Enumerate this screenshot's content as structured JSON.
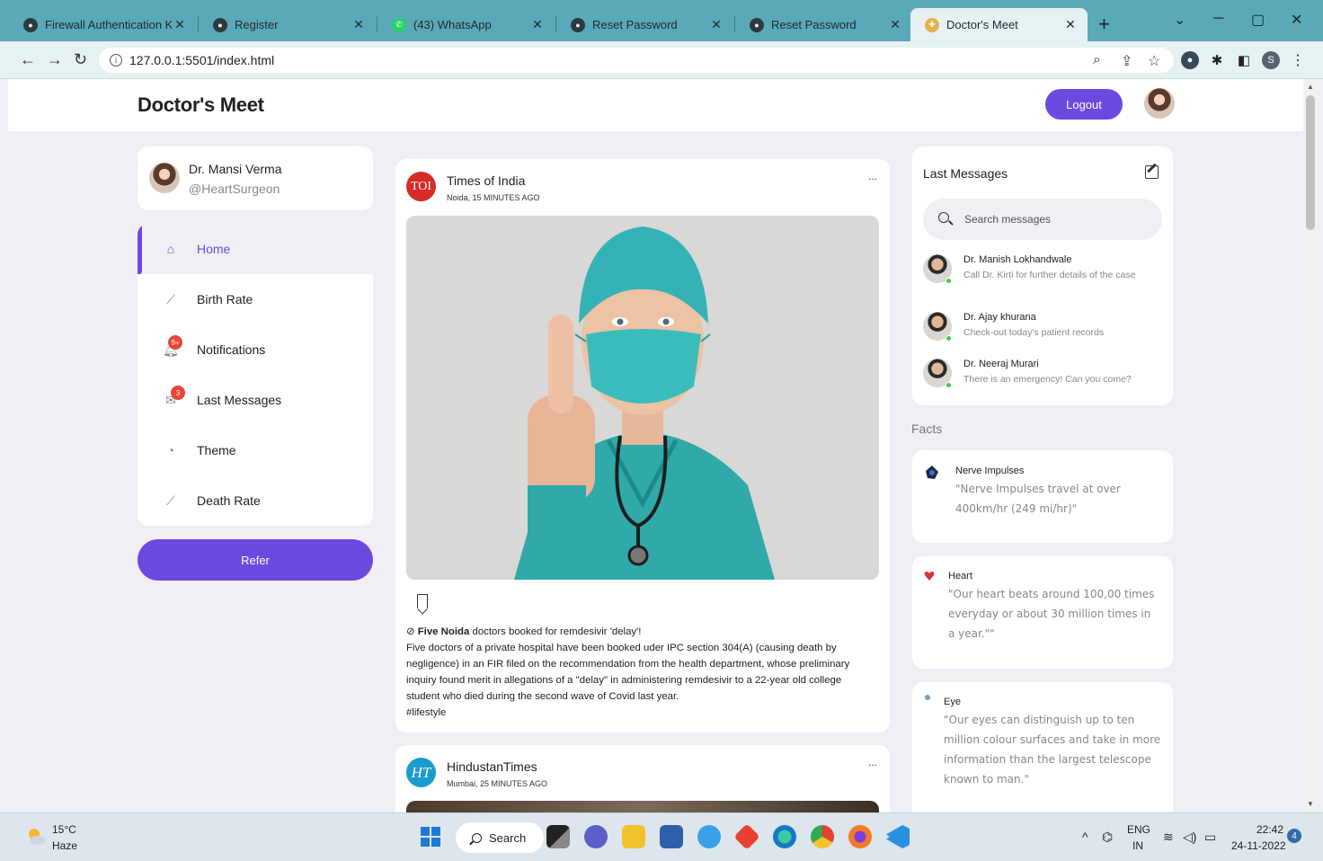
{
  "browser": {
    "tabs": [
      {
        "title": "Firewall Authentication Keep",
        "icon": "globe-icon"
      },
      {
        "title": "Register",
        "icon": "globe-icon"
      },
      {
        "title": "(43) WhatsApp",
        "icon": "whatsapp-icon"
      },
      {
        "title": "Reset Password",
        "icon": "globe-icon"
      },
      {
        "title": "Reset Password",
        "icon": "globe-icon"
      },
      {
        "title": "Doctor's Meet",
        "icon": "doctor-icon"
      }
    ],
    "url": "127.0.0.1:5501/index.html",
    "profile_initial": "S"
  },
  "header": {
    "logo": "Doctor's Meet",
    "logout_label": "Logout"
  },
  "profile": {
    "name": "Dr. Mansi Verma",
    "handle": "@HeartSurgeon"
  },
  "menu": [
    {
      "label": "Home",
      "icon": "home-icon",
      "active": true
    },
    {
      "label": "Birth Rate",
      "icon": "chart-line-icon"
    },
    {
      "label": "Notifications",
      "icon": "bell-icon",
      "badge": "9+"
    },
    {
      "label": "Last Messages",
      "icon": "mail-icon",
      "badge": "3"
    },
    {
      "label": "Theme",
      "icon": "palette-icon"
    },
    {
      "label": "Death Rate",
      "icon": "chart-line-icon"
    }
  ],
  "refer_label": "Refer",
  "posts": [
    {
      "source": "Times of India",
      "logo_text": "TOI",
      "meta": "Noida, 15 MINUTES AGO",
      "more": "...",
      "headline_bold": "Five Noida",
      "headline_rest": " doctors booked for remdesivir 'delay'!",
      "body": "Five doctors of a private hospital have been booked uder IPC section 304(A) (causing death by negligence) in an FIR filed on the recommendation from the health department, whose preliminary inquiry found merit in allegations of a \"delay\" in administering remdesivir to a 22-year old college student who died during the second wave of Covid last year.",
      "tag": "#lifestyle"
    },
    {
      "source": "HindustanTimes",
      "logo_text": "HT",
      "meta": "Mumbai, 25 MINUTES AGO",
      "more": "..."
    }
  ],
  "messages": {
    "title": "Last Messages",
    "search_placeholder": "Search messages",
    "items": [
      {
        "name": "Dr. Manish Lokhandwale",
        "preview": "Call Dr. Kirti for further details of the case"
      },
      {
        "name": "Dr. Ajay khurana",
        "preview": "Check-out today's patient records"
      },
      {
        "name": "Dr. Neeraj Murari",
        "preview": "There is an emergency! Can you come?"
      }
    ]
  },
  "facts": {
    "title": "Facts",
    "items": [
      {
        "name": "Nerve Impulses",
        "text": "\"Nerve Impulses travel at over 400km/hr (249 mi/hr)\"",
        "icon": "neuron-icon"
      },
      {
        "name": "Heart",
        "text": "\"Our heart beats around 100,00 times everyday or about 30 million times in a year.\"\"",
        "icon": "heart-icon"
      },
      {
        "name": "Eye",
        "text": "\"Our eyes can distinguish up to ten million colour surfaces and take in more information than the largest telescope known to man.\"",
        "icon": "eye-icon"
      }
    ]
  },
  "taskbar": {
    "temperature": "15°C",
    "condition": "Haze",
    "search_label": "Search",
    "language": "ENG",
    "region": "IN",
    "time": "22:42",
    "date": "24-11-2022",
    "notification_count": "4"
  },
  "colors": {
    "accent": "#6c4ae0",
    "tabbar": "#5aa9b8",
    "online": "#3ccf4e",
    "badge": "#e8443a"
  }
}
